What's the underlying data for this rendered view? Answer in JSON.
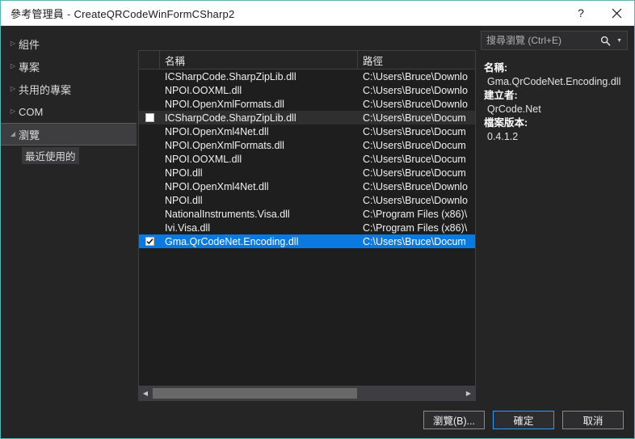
{
  "window": {
    "title_main": "參考管理員",
    "title_sep": "-",
    "title_project": "CreateQRCodeWinFormCSharp2",
    "help_glyph": "?",
    "close_name": "close-icon"
  },
  "sidebar": {
    "items": [
      {
        "label": "組件",
        "arrow": "▷",
        "selected": false
      },
      {
        "label": "專案",
        "arrow": "▷",
        "selected": false
      },
      {
        "label": "共用的專案",
        "arrow": "▷",
        "selected": false
      },
      {
        "label": "COM",
        "arrow": "▷",
        "selected": false
      },
      {
        "label": "瀏覽",
        "arrow": "◢",
        "selected": true
      }
    ],
    "child": {
      "label": "最近使用的"
    }
  },
  "search": {
    "placeholder": "搜尋瀏覽 (Ctrl+E)",
    "value": ""
  },
  "list": {
    "headers": {
      "check": "",
      "name": "名稱",
      "path": "路徑"
    },
    "rows": [
      {
        "checked": false,
        "showbox": false,
        "name": "ICSharpCode.SharpZipLib.dll",
        "path": "C:\\Users\\Bruce\\Downlo",
        "state": "normal"
      },
      {
        "checked": false,
        "showbox": false,
        "name": "NPOI.OOXML.dll",
        "path": "C:\\Users\\Bruce\\Downlo",
        "state": "normal"
      },
      {
        "checked": false,
        "showbox": false,
        "name": "NPOI.OpenXmlFormats.dll",
        "path": "C:\\Users\\Bruce\\Downlo",
        "state": "normal"
      },
      {
        "checked": false,
        "showbox": true,
        "name": "ICSharpCode.SharpZipLib.dll",
        "path": "C:\\Users\\Bruce\\Docum",
        "state": "hover"
      },
      {
        "checked": false,
        "showbox": false,
        "name": "NPOI.OpenXml4Net.dll",
        "path": "C:\\Users\\Bruce\\Docum",
        "state": "normal"
      },
      {
        "checked": false,
        "showbox": false,
        "name": "NPOI.OpenXmlFormats.dll",
        "path": "C:\\Users\\Bruce\\Docum",
        "state": "normal"
      },
      {
        "checked": false,
        "showbox": false,
        "name": "NPOI.OOXML.dll",
        "path": "C:\\Users\\Bruce\\Docum",
        "state": "normal"
      },
      {
        "checked": false,
        "showbox": false,
        "name": "NPOI.dll",
        "path": "C:\\Users\\Bruce\\Docum",
        "state": "normal"
      },
      {
        "checked": false,
        "showbox": false,
        "name": "NPOI.OpenXml4Net.dll",
        "path": "C:\\Users\\Bruce\\Downlo",
        "state": "normal"
      },
      {
        "checked": false,
        "showbox": false,
        "name": "NPOI.dll",
        "path": "C:\\Users\\Bruce\\Downlo",
        "state": "normal"
      },
      {
        "checked": false,
        "showbox": false,
        "name": "NationalInstruments.Visa.dll",
        "path": "C:\\Program Files (x86)\\",
        "state": "normal"
      },
      {
        "checked": false,
        "showbox": false,
        "name": "Ivi.Visa.dll",
        "path": "C:\\Program Files (x86)\\",
        "state": "normal"
      },
      {
        "checked": true,
        "showbox": true,
        "name": "Gma.QrCodeNet.Encoding.dll",
        "path": "C:\\Users\\Bruce\\Docum",
        "state": "selected"
      }
    ]
  },
  "details": {
    "name_label": "名稱:",
    "name_value": "Gma.QrCodeNet.Encoding.dll",
    "creator_label": "建立者:",
    "creator_value": "QrCode.Net",
    "version_label": "檔案版本:",
    "version_value": "0.4.1.2"
  },
  "footer": {
    "browse": "瀏覽(B)...",
    "ok": "確定",
    "cancel": "取消"
  },
  "colors": {
    "accent_selection": "#0a7ae0",
    "window_border": "#5bb3b3",
    "dialog_bg": "#252526",
    "list_bg": "#1e1e1e",
    "focus_border": "#3399ff"
  }
}
